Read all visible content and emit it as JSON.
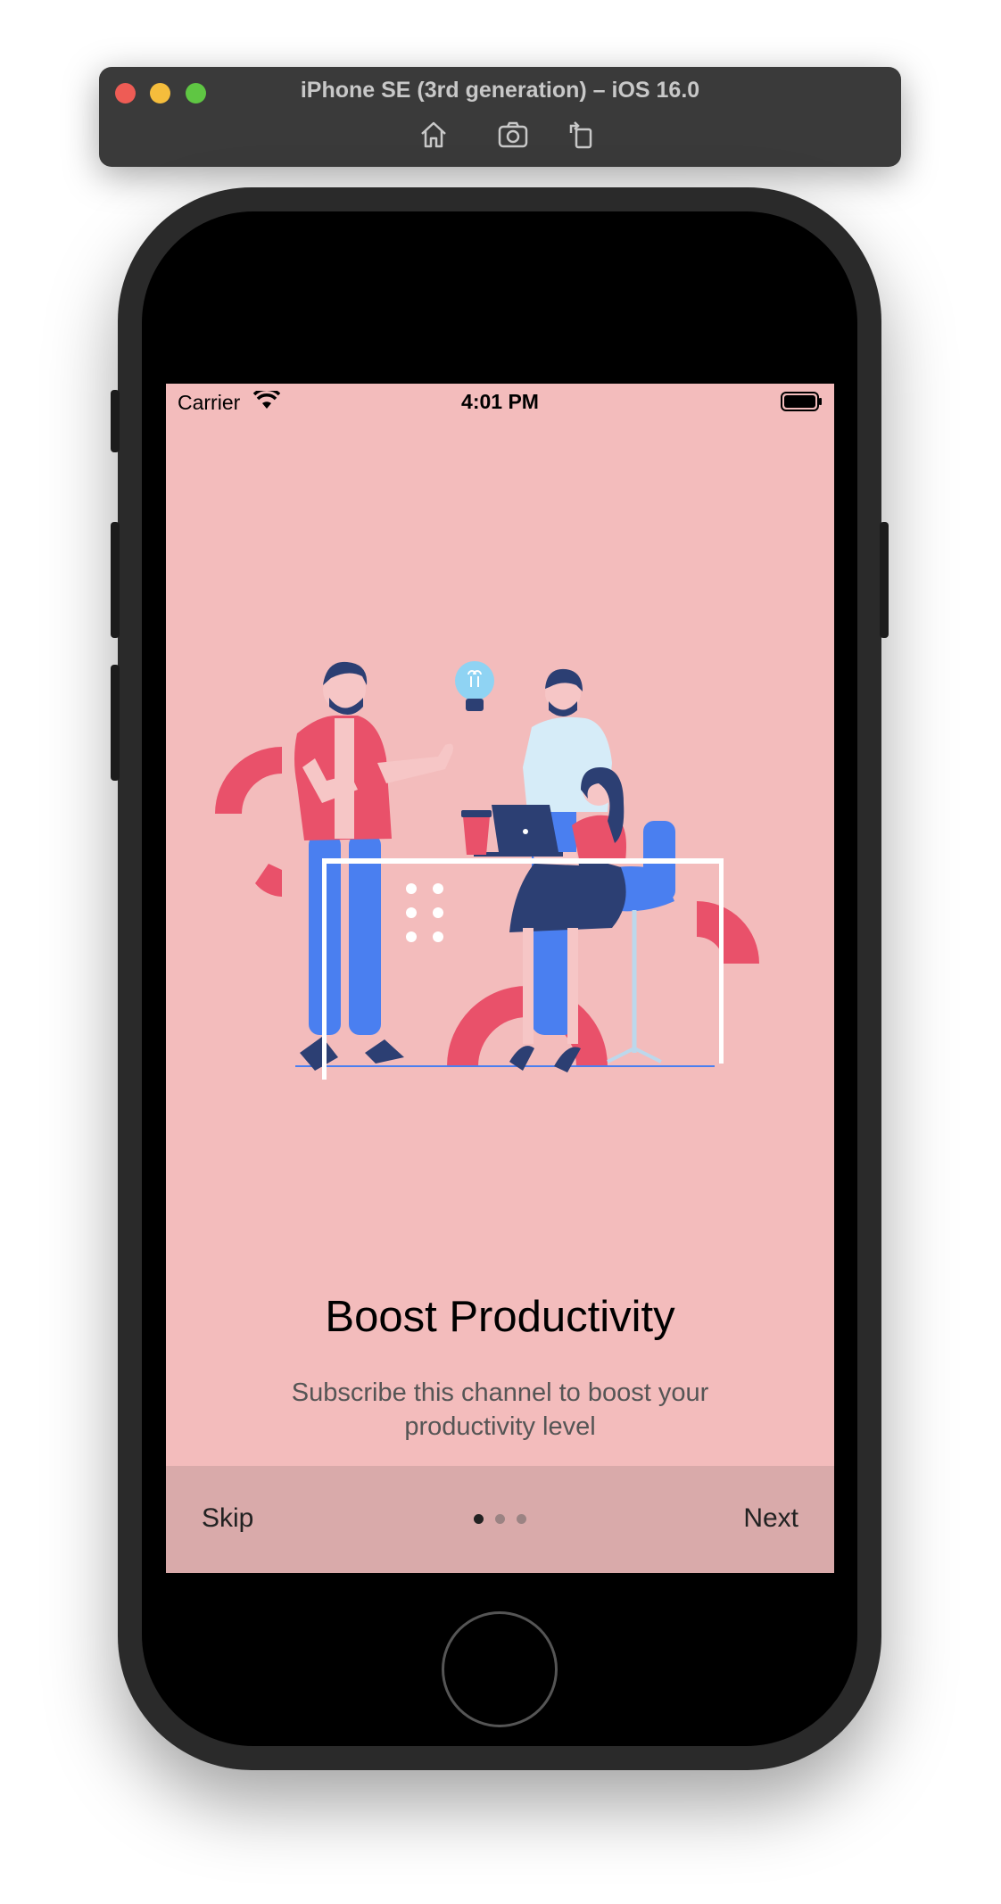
{
  "simulator": {
    "title": "iPhone SE (3rd generation) – iOS 16.0",
    "tools": [
      "home-icon",
      "screenshot-icon",
      "rotate-icon"
    ]
  },
  "status_bar": {
    "carrier": "Carrier",
    "time": "4:01 PM"
  },
  "onboarding": {
    "title": "Boost Productivity",
    "subtitle": "Subscribe this channel to boost your productivity level",
    "illustration": "team-working-illustration",
    "skip_label": "Skip",
    "next_label": "Next",
    "page_count": 3,
    "current_page": 1
  },
  "colors": {
    "screen_background": "#f3bcbc",
    "bottom_bar": "#d9aaaa",
    "accent_red": "#e9516a",
    "accent_blue": "#4a7ff0",
    "navy": "#2c3f73"
  }
}
